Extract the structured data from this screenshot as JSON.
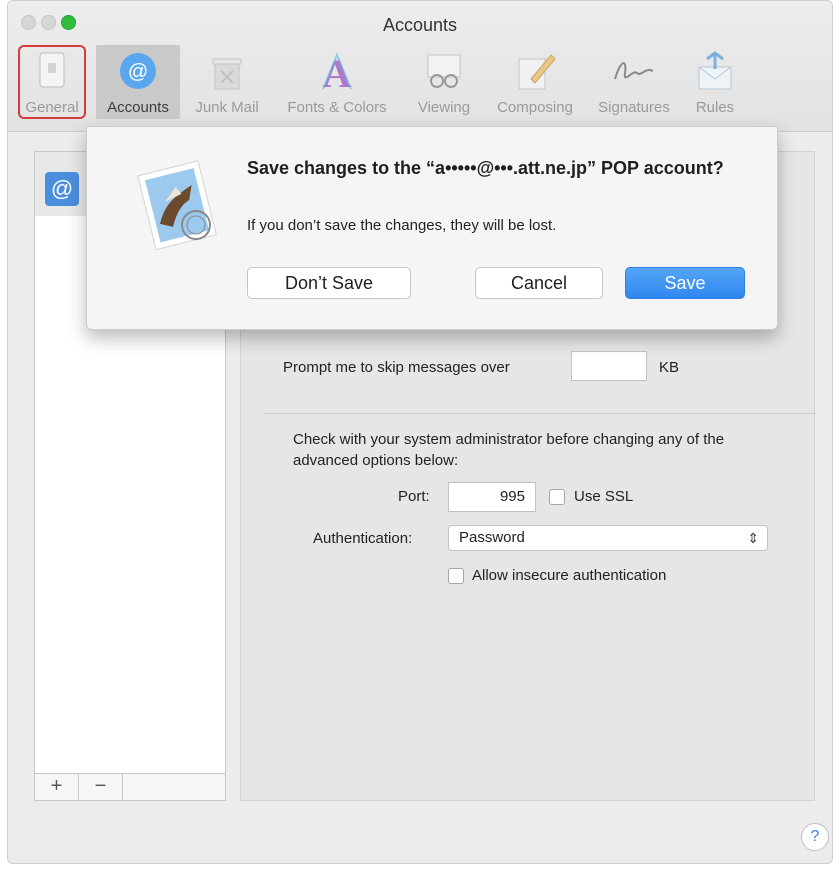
{
  "window": {
    "title": "Accounts"
  },
  "toolbar": {
    "items": [
      {
        "label": "General",
        "icon": "general-icon"
      },
      {
        "label": "Accounts",
        "icon": "at-sign-icon"
      },
      {
        "label": "Junk Mail",
        "icon": "trash-icon"
      },
      {
        "label": "Fonts & Colors",
        "icon": "fonts-colors-icon"
      },
      {
        "label": "Viewing",
        "icon": "glasses-icon"
      },
      {
        "label": "Composing",
        "icon": "pencil-icon"
      },
      {
        "label": "Signatures",
        "icon": "signature-icon"
      },
      {
        "label": "Rules",
        "icon": "rules-envelope-icon"
      }
    ]
  },
  "sidebar": {
    "account_badge": "@",
    "add_label": "+",
    "remove_label": "−"
  },
  "settings": {
    "prompt_label": "Prompt me to skip messages over",
    "prompt_value": "",
    "kb_label": "KB",
    "advanced_note": "Check with your system administrator before changing any of the advanced options below:",
    "port_label": "Port:",
    "port_value": "995",
    "use_ssl_label": "Use SSL",
    "auth_label": "Authentication:",
    "auth_value": "Password",
    "insecure_label": "Allow insecure authentication"
  },
  "dialog": {
    "title": "Save changes to the “a•••••@•••.att.ne.jp” POP account?",
    "message": "If you don’t save the changes, they will be lost.",
    "dont_save": "Don’t Save",
    "cancel": "Cancel",
    "save": "Save"
  },
  "help": {
    "label": "?"
  },
  "colors": {
    "accent_blue": "#2f86ef",
    "highlight_outline": "#d63b3b"
  }
}
